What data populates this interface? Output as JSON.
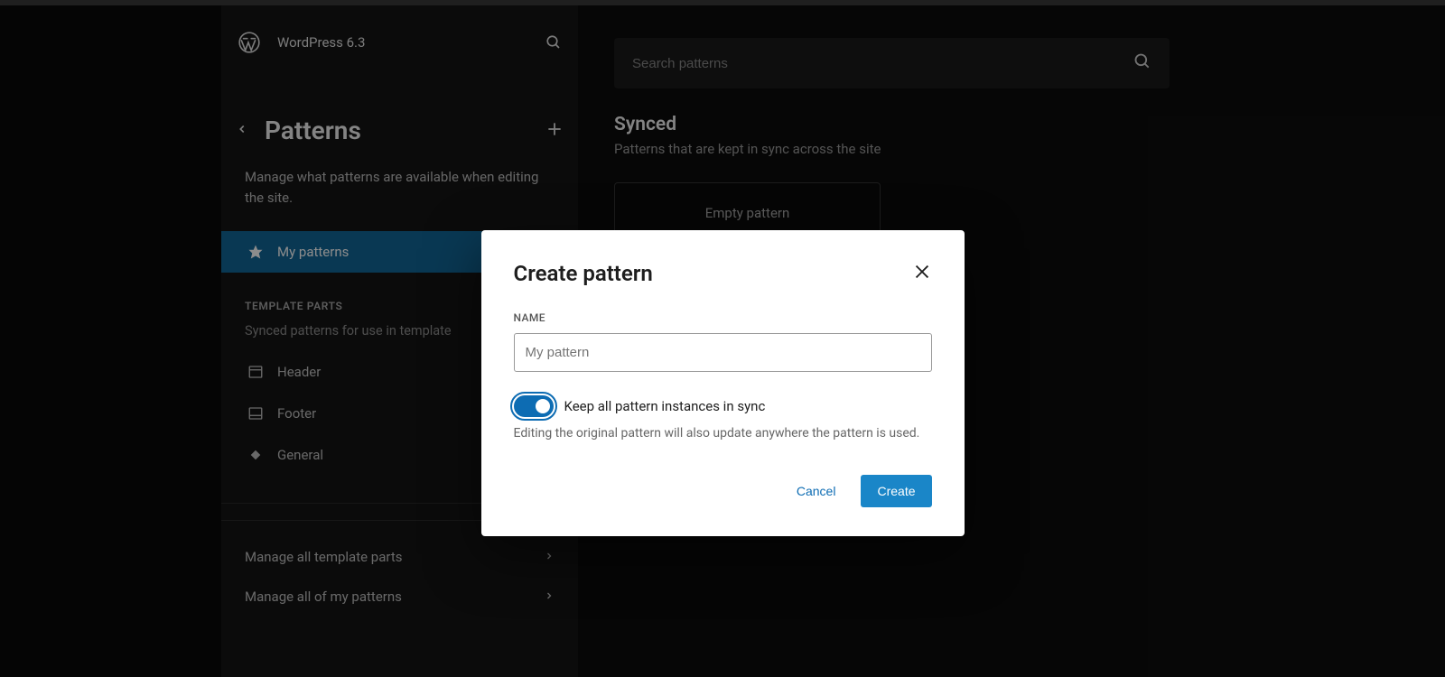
{
  "header": {
    "site_title": "WordPress 6.3"
  },
  "sidebar": {
    "title": "Patterns",
    "description": "Manage what patterns are available when editing the site.",
    "nav": {
      "my_patterns": "My patterns"
    },
    "template_parts": {
      "heading": "TEMPLATE PARTS",
      "description": "Synced patterns for use in template",
      "items": {
        "header": "Header",
        "footer": "Footer",
        "general": "General"
      }
    },
    "manage": {
      "template_parts": "Manage all template parts",
      "my_patterns": "Manage all of my patterns"
    }
  },
  "main": {
    "search_placeholder": "Search patterns",
    "section_title": "Synced",
    "section_desc": "Patterns that are kept in sync across the site",
    "empty_card": "Empty pattern"
  },
  "modal": {
    "title": "Create pattern",
    "name_label": "NAME",
    "name_placeholder": "My pattern",
    "toggle_label": "Keep all pattern instances in sync",
    "toggle_desc": "Editing the original pattern will also update anywhere the pattern is used.",
    "cancel": "Cancel",
    "create": "Create"
  }
}
